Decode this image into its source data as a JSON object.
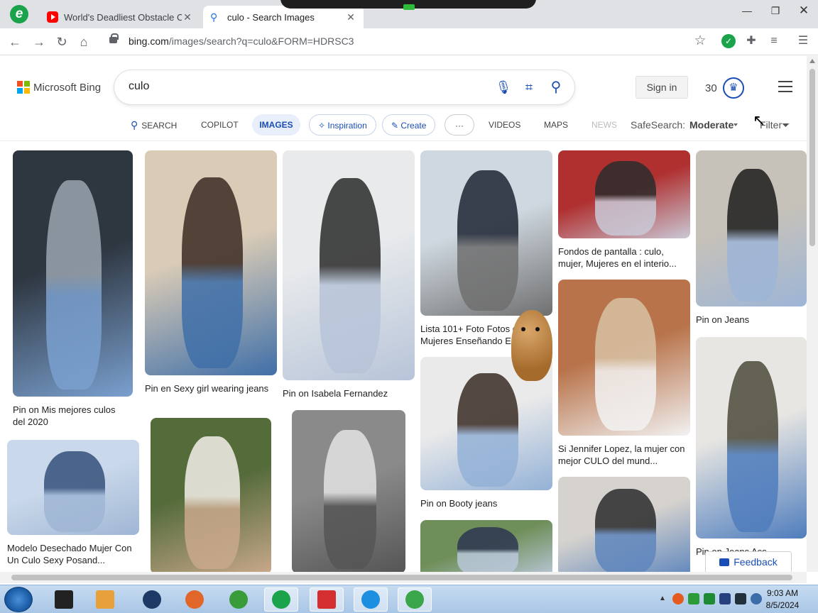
{
  "browser": {
    "tabs": [
      {
        "title": "World's Deadliest Obstacle Co",
        "icon": "youtube-icon"
      },
      {
        "title": "culo - Search Images",
        "icon": "search-icon"
      }
    ],
    "url_domain": "bing.com",
    "url_path": "/images/search?q=culo&FORM=HDRSC3"
  },
  "header": {
    "brand": "Microsoft Bing",
    "query": "culo",
    "sign_in": "Sign in",
    "points": "30"
  },
  "scopes": {
    "search": "SEARCH",
    "copilot": "COPILOT",
    "images": "IMAGES",
    "inspiration": "Inspiration",
    "create": "Create",
    "more": "···",
    "videos": "VIDEOS",
    "maps": "MAPS",
    "news": "NEWS",
    "safesearch_label": "SafeSearch:",
    "safesearch_value": "Moderate",
    "filter": "Filter"
  },
  "results": [
    {
      "caption": "Pin on Mis mejores culos del 2020",
      "colors": [
        "#2e3640",
        "#9aa4ae",
        "#7aa0cf"
      ]
    },
    {
      "caption": "Pin en Sexy girl wearing jeans",
      "colors": [
        "#d9cbb6",
        "#3b2a22",
        "#3f6fa8"
      ]
    },
    {
      "caption": "Pin on Isabela Fernandez",
      "colors": [
        "#e8eaec",
        "#2a2a2a",
        "#b7c4d8"
      ]
    },
    {
      "caption": "Lista 101+ Foto Fotos de Mujeres Enseñando E...",
      "colors": [
        "#cfd8e0",
        "#1d2433",
        "#6f6f6f"
      ]
    },
    {
      "caption": "Fondos de pantalla : culo, mujer, Mujeres en el interio...",
      "colors": [
        "#b03030",
        "#2b2b2b",
        "#c9c9d6"
      ]
    },
    {
      "caption": "Pin on Jeans",
      "colors": [
        "#c7c2b9",
        "#1c1c1c",
        "#9db5d6"
      ]
    },
    {
      "caption": "Modelo Desechado Mujer Con Un Culo Sexy Posand...",
      "colors": [
        "#c9d8ea",
        "#34507a",
        "#9fb6d4"
      ]
    },
    {
      "caption": "Pin on Booty jeans",
      "colors": [
        "#eaeaea",
        "#3a2b24",
        "#93b1d6"
      ]
    },
    {
      "caption": "Si Jennifer Lopez, la mujer con mejor CULO del mund...",
      "colors": [
        "#b8734a",
        "#d8c2a4",
        "#f2f2f2"
      ]
    },
    {
      "caption": "Pin on Jeans Ass",
      "colors": [
        "#e8e6e2",
        "#4c4a3a",
        "#4f7dbd"
      ]
    },
    {
      "caption": "",
      "colors": [
        "#546b3a",
        "#f3efe9",
        "#c9a88b"
      ]
    },
    {
      "caption": "",
      "colors": [
        "#8a8a8a",
        "#e3e3e3",
        "#555555"
      ]
    },
    {
      "caption": "",
      "colors": [
        "#6f8f5a",
        "#2c3650",
        "#b9c7d8"
      ]
    },
    {
      "caption": "",
      "colors": [
        "#d6d3ce",
        "#2b2b2b",
        "#5f86bd"
      ]
    }
  ],
  "feedback": "Feedback",
  "taskbar": {
    "time": "9:03 AM",
    "date": "8/5/2024",
    "apps": [
      "file-manager-icon",
      "media-player-icon",
      "globe-icon",
      "firefox-icon",
      "chrome-icon",
      "edge-icon",
      "wps-icon",
      "skype-icon",
      "plus-app-icon"
    ]
  },
  "colors": {
    "accent": "#1a4db5",
    "taskbar": "#bcd4ee"
  }
}
